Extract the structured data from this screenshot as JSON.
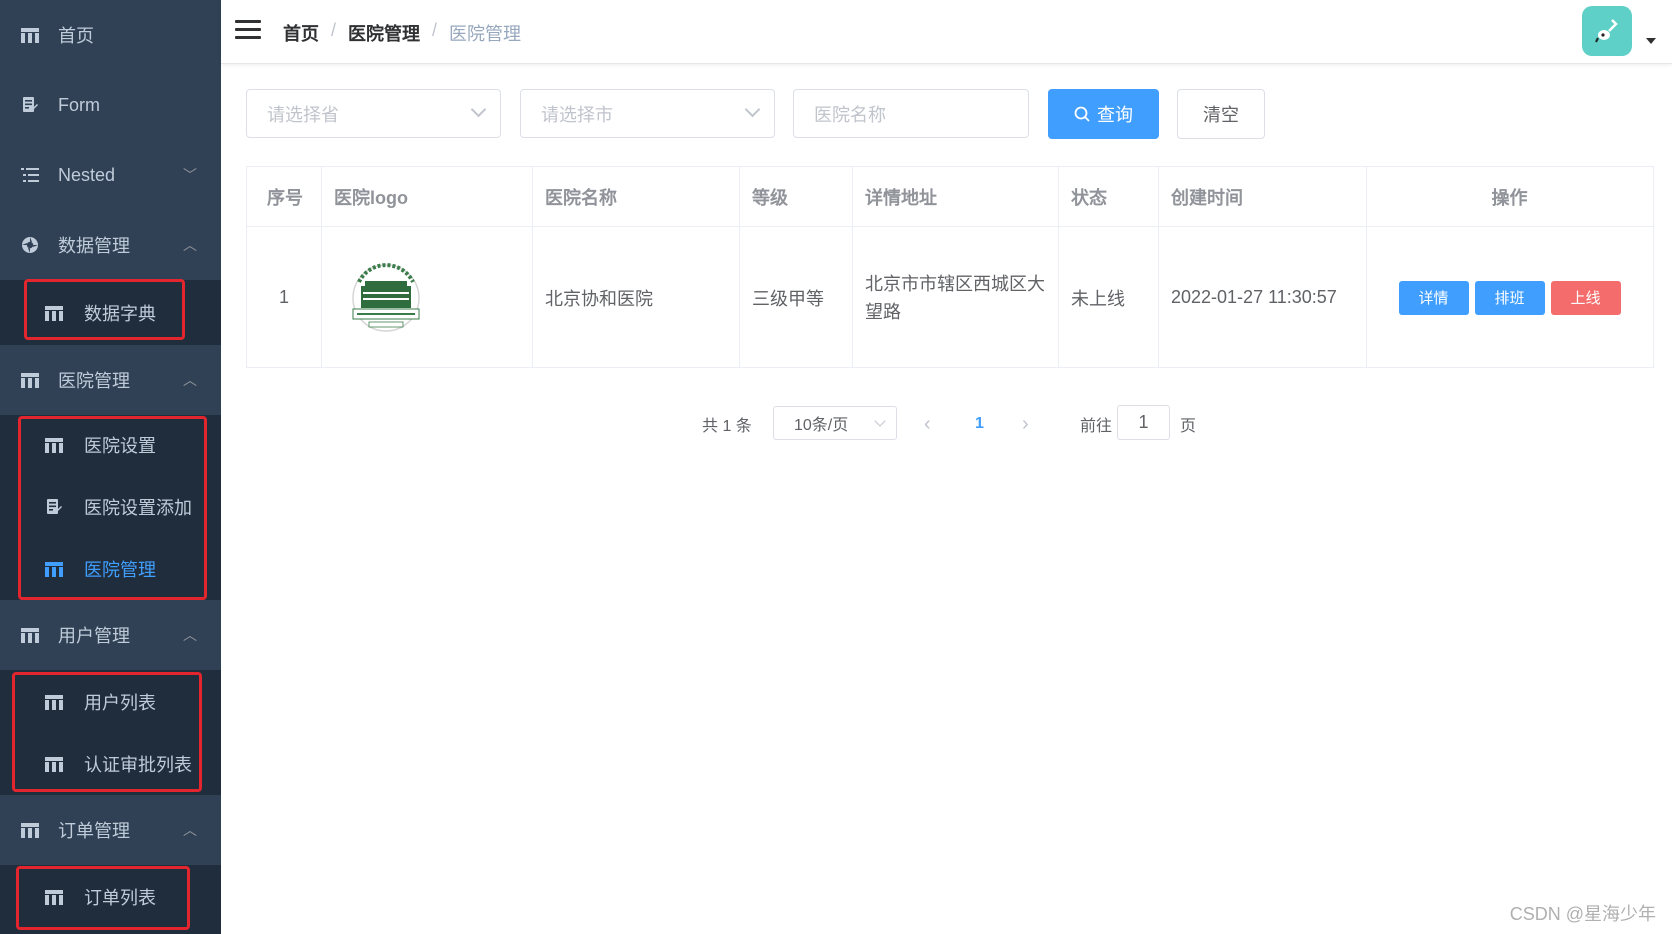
{
  "sidebar": {
    "home": "首页",
    "form": "Form",
    "nested": "Nested",
    "data_mgmt": "数据管理",
    "data_dict": "数据字典",
    "hospital_mgmt": "医院管理",
    "hospital_settings": "医院设置",
    "hospital_settings_add": "医院设置添加",
    "hospital_mgmt_sub": "医院管理",
    "user_mgmt": "用户管理",
    "user_list": "用户列表",
    "auth_review_list": "认证审批列表",
    "order_mgmt": "订单管理",
    "order_list": "订单列表"
  },
  "breadcrumb": {
    "item1": "首页",
    "item2": "医院管理",
    "item3": "医院管理",
    "separator": "/"
  },
  "filters": {
    "province_placeholder": "请选择省",
    "city_placeholder": "请选择市",
    "name_placeholder": "医院名称",
    "query_label": "查询",
    "clear_label": "清空"
  },
  "table": {
    "headers": [
      "序号",
      "医院logo",
      "医院名称",
      "等级",
      "详情地址",
      "状态",
      "创建时间",
      "操作"
    ],
    "rows": [
      {
        "index": "1",
        "name": "北京协和医院",
        "level": "三级甲等",
        "address": "北京市市辖区西城区大望路",
        "status": "未上线",
        "created": "2022-01-27 11:30:57",
        "actions": {
          "detail": "详情",
          "schedule": "排班",
          "online": "上线"
        }
      }
    ]
  },
  "pagination": {
    "total": "共 1 条",
    "page_size": "10条/页",
    "current_page": "1",
    "goto_label": "前往",
    "goto_value": "1",
    "page_suffix": "页"
  },
  "watermark": "CSDN @星海少年",
  "colors": {
    "sidebar_bg": "#304156",
    "submenu_bg": "#1f2d3d",
    "primary": "#409eff",
    "danger": "#f56c6c",
    "highlight_border": "#e3262e"
  }
}
